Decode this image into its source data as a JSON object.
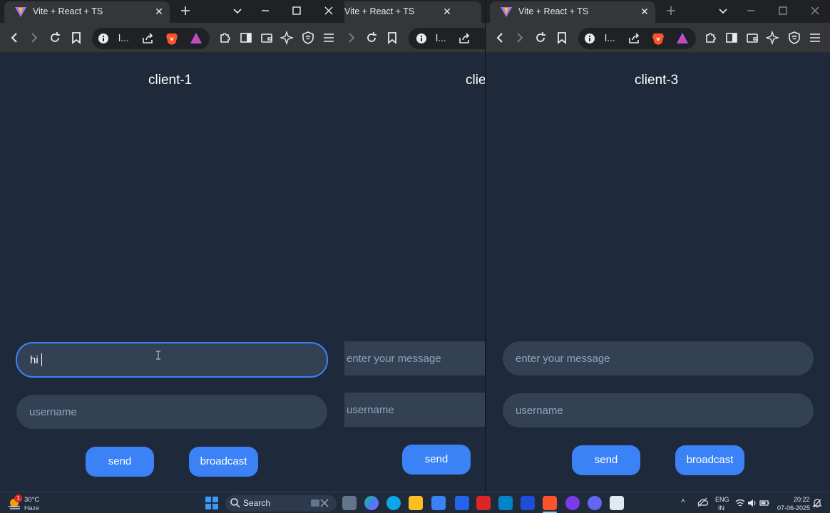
{
  "windows": [
    {
      "tab_title": "Vite + React + TS",
      "url_display": "l...",
      "client_title": "client-1",
      "message_value": "hi",
      "username_placeholder": "username",
      "send_label": "send",
      "broadcast_label": "broadcast"
    },
    {
      "tab_title": "Vite + React + TS",
      "url_display": "l...",
      "client_title": "clie",
      "message_placeholder": "enter your message",
      "username_placeholder": "username",
      "send_label": "send"
    },
    {
      "tab_title": "Vite + React + TS",
      "url_display": "l...",
      "client_title": "client-3",
      "message_placeholder": "enter your message",
      "username_placeholder": "username",
      "send_label": "send",
      "broadcast_label": "broadcast"
    }
  ],
  "taskbar": {
    "weather_temp": "30°C",
    "weather_desc": "Haze",
    "weather_badge": "1",
    "search_label": "Search",
    "lang_top": "ENG",
    "lang_bottom": "IN",
    "time": "20:22",
    "date": "07-06-2025"
  },
  "colors": {
    "page_bg": "#1e293b",
    "input_bg": "#334155",
    "accent": "#3b82f6",
    "browser_chrome": "#35363a",
    "tabstrip": "#202124"
  },
  "icons": {
    "back": "chevron-left-icon",
    "forward": "chevron-right-icon",
    "reload": "reload-icon",
    "bookmark": "bookmark-icon",
    "site_info": "info-icon",
    "share": "share-icon",
    "brave_shields": "brave-lion-icon",
    "brave_rewards": "rewards-triangle-icon",
    "extensions": "puzzle-icon",
    "sidebar": "sidebar-icon",
    "wallet": "wallet-icon",
    "leo": "sparkle-icon",
    "vpn": "shield-icon",
    "menu": "hamburger-icon"
  }
}
